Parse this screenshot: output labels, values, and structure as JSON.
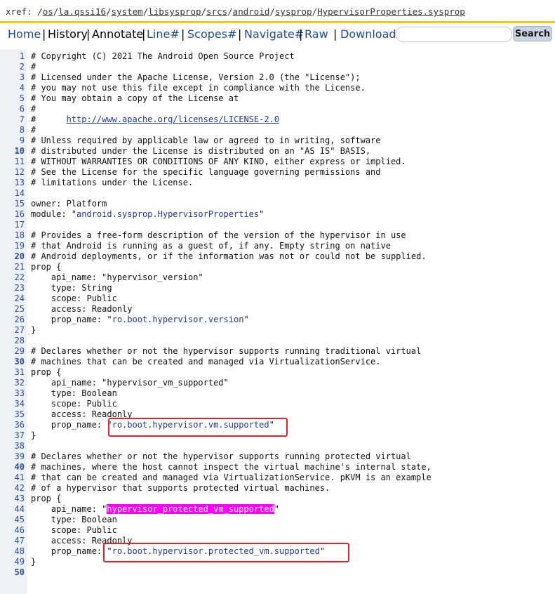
{
  "breadcrumb": {
    "prefix": "xref: /",
    "segments": [
      "os",
      "la.qssi16",
      "system",
      "libsysprop",
      "srcs",
      "android",
      "sysprop",
      "HypervisorProperties.sysprop"
    ]
  },
  "nav": {
    "home": "Home",
    "history": "History",
    "annotate": "Annotate",
    "line": "Line#",
    "scopes": "Scopes#",
    "navigate": "Navigate#",
    "raw": "Raw",
    "download": "Download",
    "search_button": "Search",
    "search_value": ""
  },
  "lines": [
    {
      "n": "1",
      "t": "# Copyright (C) 2021 The Android Open Source Project"
    },
    {
      "n": "2",
      "t": "#"
    },
    {
      "n": "3",
      "t": "# Licensed under the Apache License, Version 2.0 (the \"License\");"
    },
    {
      "n": "4",
      "t": "# you may not use this file except in compliance with the License."
    },
    {
      "n": "5",
      "t": "# You may obtain a copy of the License at"
    },
    {
      "n": "6",
      "t": "#"
    },
    {
      "n": "7",
      "t": "#      ",
      "link": "http://www.apache.org/licenses/LICENSE-2.0"
    },
    {
      "n": "8",
      "t": "#"
    },
    {
      "n": "9",
      "t": "# Unless required by applicable law or agreed to in writing, software"
    },
    {
      "n": "10",
      "t": "# distributed under the License is distributed on an \"AS IS\" BASIS,"
    },
    {
      "n": "11",
      "t": "# WITHOUT WARRANTIES OR CONDITIONS OF ANY KIND, either express or implied."
    },
    {
      "n": "12",
      "t": "# See the License for the specific language governing permissions and"
    },
    {
      "n": "13",
      "t": "# limitations under the License."
    },
    {
      "n": "14",
      "t": ""
    },
    {
      "n": "15",
      "t": "owner: Platform"
    },
    {
      "n": "16",
      "t": "module: \"",
      "s": "android.sysprop.HypervisorProperties",
      "e": "\""
    },
    {
      "n": "17",
      "t": ""
    },
    {
      "n": "18",
      "t": "# Provides a free-form description of the version of the hypervisor in use"
    },
    {
      "n": "19",
      "t": "# that Android is running as a guest of, if any. Empty string on native"
    },
    {
      "n": "20",
      "t": "# Android deployments, or if the information was not or could not be supplied."
    },
    {
      "n": "21",
      "t": "prop {"
    },
    {
      "n": "22",
      "t": "    api_name: \"hypervisor_version\""
    },
    {
      "n": "23",
      "t": "    type: String"
    },
    {
      "n": "24",
      "t": "    scope: Public"
    },
    {
      "n": "25",
      "t": "    access: Readonly"
    },
    {
      "n": "26",
      "t": "    prop_name: \"",
      "s": "ro.boot.hypervisor.version",
      "e": "\""
    },
    {
      "n": "27",
      "t": "}"
    },
    {
      "n": "28",
      "t": ""
    },
    {
      "n": "29",
      "t": "# Declares whether or not the hypervisor supports running traditional virtual"
    },
    {
      "n": "30",
      "t": "# machines that can be created and managed via VirtualizationService."
    },
    {
      "n": "31",
      "t": "prop {"
    },
    {
      "n": "32",
      "t": "    api_name: \"hypervisor_vm_supported\""
    },
    {
      "n": "33",
      "t": "    type: Boolean"
    },
    {
      "n": "34",
      "t": "    scope: Public"
    },
    {
      "n": "35",
      "t": "    access: Readonly"
    },
    {
      "n": "36",
      "t": "    prop_name: \"",
      "s": "ro.boot.hypervisor.vm.supported",
      "e": "\""
    },
    {
      "n": "37",
      "t": "}"
    },
    {
      "n": "38",
      "t": ""
    },
    {
      "n": "39",
      "t": "# Declares whether or not the hypervisor supports running protected virtual"
    },
    {
      "n": "40",
      "t": "# machines, where the host cannot inspect the virtual machine's internal state,"
    },
    {
      "n": "41",
      "t": "# that can be created and managed via VirtualizationService. pKVM is an example"
    },
    {
      "n": "42",
      "t": "# of a hypervisor that supports protected virtual machines."
    },
    {
      "n": "43",
      "t": "prop {"
    },
    {
      "n": "44",
      "t": "    api_name: \"",
      "h": "hypervisor_protected_vm_supported",
      "e": "\""
    },
    {
      "n": "45",
      "t": "    type: Boolean"
    },
    {
      "n": "46",
      "t": "    scope: Public"
    },
    {
      "n": "47",
      "t": "    access: Readonly"
    },
    {
      "n": "48",
      "t": "    prop_name: \"",
      "s": "ro.boot.hypervisor.protected_vm.supported",
      "e": "\""
    },
    {
      "n": "49",
      "t": "}"
    },
    {
      "n": "50",
      "t": ""
    }
  ],
  "colors": {
    "accent_bar": "#f2c329",
    "link": "#1f4c8f",
    "highlight": "#ff00ff",
    "annotation_box": "#e0242a"
  }
}
